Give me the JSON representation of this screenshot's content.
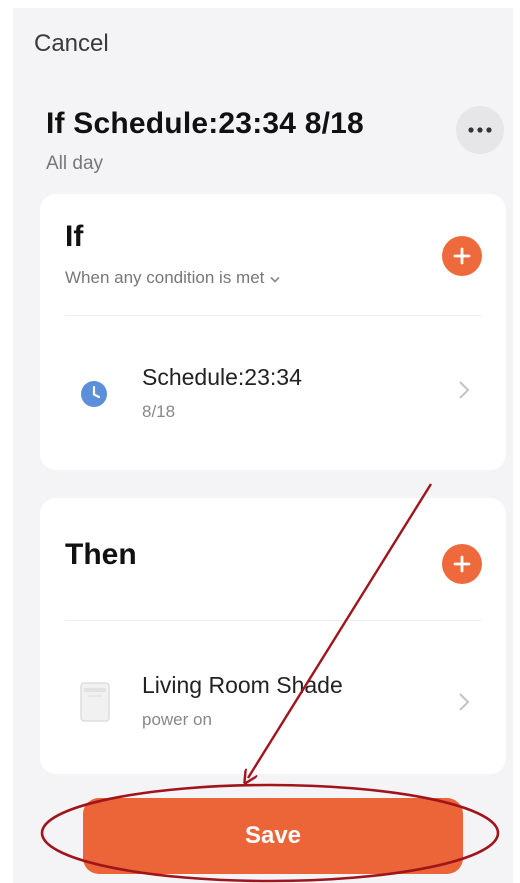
{
  "header": {
    "cancel_label": "Cancel",
    "title": "If Schedule:23:34 8/18",
    "subtitle": "All day"
  },
  "if_section": {
    "heading": "If",
    "condition_mode": "When any condition is met",
    "items": [
      {
        "title": "Schedule:23:34",
        "subtitle": "8/18",
        "icon": "clock-icon"
      }
    ]
  },
  "then_section": {
    "heading": "Then",
    "items": [
      {
        "title": "Living Room Shade",
        "subtitle": "power on",
        "icon": "shade-device-icon"
      }
    ]
  },
  "footer": {
    "save_label": "Save"
  },
  "colors": {
    "accent": "#ec6538",
    "background": "#f4f4f6",
    "card": "#ffffff",
    "clock": "#5b8fd9",
    "annotation": "#a0141c"
  }
}
